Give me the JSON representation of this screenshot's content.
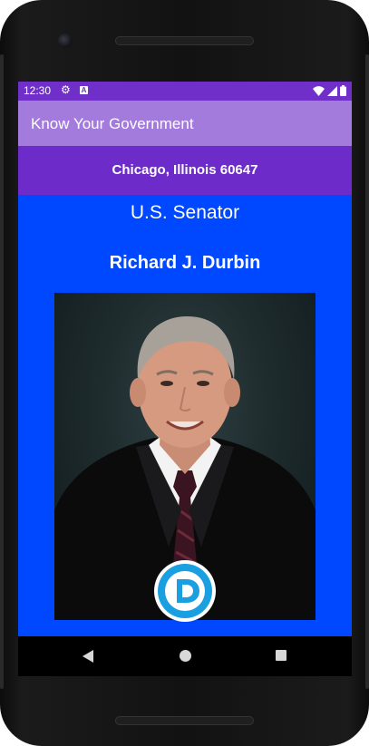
{
  "status_bar": {
    "time": "12:30",
    "icons": [
      "gear-icon",
      "a-icon",
      "wifi-icon",
      "signal-icon",
      "battery-icon"
    ],
    "color": "#6f2fc8"
  },
  "app_bar": {
    "title": "Know Your Government",
    "color": "#a37bdc"
  },
  "location": {
    "text": "Chicago, Illinois 60647",
    "color": "#6d2cc9"
  },
  "official": {
    "office": "U.S. Senator",
    "name": "Richard J. Durbin",
    "party_logo": "D",
    "background_color": "#0048ff",
    "party_color": "#1a9fe0"
  },
  "nav_bar": {
    "icons": [
      "back-icon",
      "home-icon",
      "recents-icon"
    ]
  }
}
